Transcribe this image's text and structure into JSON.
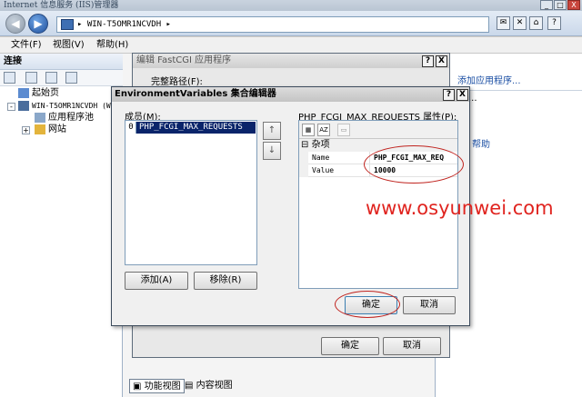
{
  "window": {
    "title": "Internet 信息服务 (IIS)管理器",
    "min_label": "_",
    "max_label": "□",
    "close_label": "X"
  },
  "navbar": {
    "back_label": "◀",
    "forward_label": "▶",
    "address": "▸ WIN-T5OMR1NCVDH ▸"
  },
  "toolbar": {
    "icon1_label": "✉",
    "icon2_label": "✕",
    "icon3_label": "⌂",
    "help_label": "?"
  },
  "menu": {
    "file": "文件(F)",
    "view": "视图(V)",
    "help": "帮助(H)"
  },
  "connections": {
    "header": "连接",
    "tree": [
      {
        "label": "起始页"
      },
      {
        "label": "WIN-T5OMR1NCVDH (W"
      },
      {
        "label": "应用程序池"
      },
      {
        "label": "网站"
      }
    ],
    "expander_plus": "+",
    "expander_minus": "-"
  },
  "actions_panel": {
    "add_app": "添加应用程序...",
    "dots": "...",
    "help": "帮助"
  },
  "bottom_tabs": {
    "features": "功能视图",
    "content": "内容视图"
  },
  "fastcgi_dialog": {
    "title": "编辑 FastCGI 应用程序",
    "full_path_label": "完整路径(F):",
    "ok": "确定",
    "cancel": "取消",
    "help_btn": "?",
    "close_btn": "X"
  },
  "env_dialog": {
    "title": "EnvironmentVariables 集合编辑器",
    "help_btn": "?",
    "close_btn": "X",
    "members_label": "成员(M):",
    "members": [
      {
        "index": "0",
        "name": "PHP_FCGI_MAX_REQUESTS"
      }
    ],
    "up_arrow": "↑",
    "down_arrow": "↓",
    "add_button": "添加(A)",
    "remove_button": "移除(R)",
    "properties_label": "PHP_FCGI_MAX_REQUESTS 属性(P):",
    "category": "杂项",
    "category_toggle": "⊟",
    "properties": [
      {
        "name": "Name",
        "value": "PHP_FCGI_MAX_REQ"
      },
      {
        "name": "Value",
        "value": "10000"
      }
    ],
    "ok": "确定",
    "cancel": "取消"
  },
  "watermark": "www.osyunwei.com",
  "colors": {
    "annotation": "#c0241f",
    "selection": "#0a246a"
  }
}
